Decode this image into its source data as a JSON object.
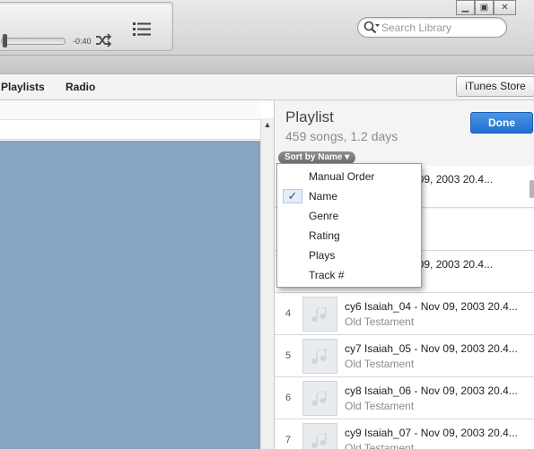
{
  "player": {
    "time_remaining": "-0:40",
    "progress_fraction": 0.05
  },
  "search": {
    "placeholder": "Search Library"
  },
  "nav": {
    "playlists": "Playlists",
    "radio": "Radio",
    "store": "iTunes Store"
  },
  "playlist": {
    "title": "Playlist",
    "subtitle": "459 songs, 1.2 days",
    "done": "Done",
    "sort_label": "Sort by Name",
    "tracks": [
      {
        "num": "",
        "name": "Nov 09, 2003 20.4...",
        "album": ""
      },
      {
        "num": "",
        "name": "",
        "album": ""
      },
      {
        "num": "",
        "name": "Nov 09, 2003 20.4...",
        "album": ""
      },
      {
        "num": "4",
        "name": "cy6 Isaiah_04 - Nov 09, 2003 20.4...",
        "album": "Old Testament"
      },
      {
        "num": "5",
        "name": "cy7 Isaiah_05 - Nov 09, 2003 20.4...",
        "album": "Old Testament"
      },
      {
        "num": "6",
        "name": "cy8 Isaiah_06 - Nov 09, 2003 20.4...",
        "album": "Old Testament"
      },
      {
        "num": "7",
        "name": "cy9 Isaiah_07 - Nov 09, 2003 20.4...",
        "album": "Old Testament"
      }
    ]
  },
  "sort_menu": {
    "items": [
      "Manual Order",
      "Name",
      "Genre",
      "Rating",
      "Plays",
      "Track #"
    ],
    "check": "✓"
  }
}
